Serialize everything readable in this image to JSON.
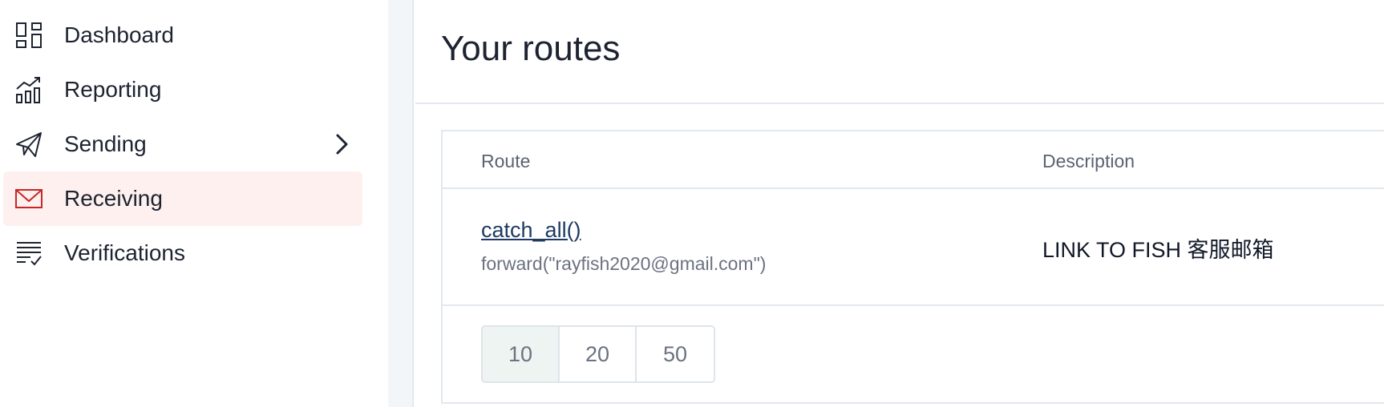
{
  "sidebar": {
    "items": [
      {
        "label": "Dashboard",
        "icon": "dashboard-icon"
      },
      {
        "label": "Reporting",
        "icon": "chart-icon"
      },
      {
        "label": "Sending",
        "icon": "paper-plane-icon",
        "has_submenu": true
      },
      {
        "label": "Receiving",
        "icon": "envelope-icon",
        "active": true
      },
      {
        "label": "Verifications",
        "icon": "list-check-icon"
      }
    ]
  },
  "main": {
    "title": "Your routes",
    "table": {
      "columns": [
        "Route",
        "Description"
      ],
      "rows": [
        {
          "route": "catch_all()",
          "action": "forward(\"rayfish2020@gmail.com\")",
          "description": "LINK TO FISH 客服邮箱"
        }
      ]
    },
    "pagination": {
      "page_sizes": [
        "10",
        "20",
        "50"
      ],
      "selected": "10"
    }
  },
  "colors": {
    "active_bg": "#fdf0ee",
    "active_icon": "#c62828",
    "link": "#1f3a63",
    "selected_page_bg": "#eef4f1"
  }
}
